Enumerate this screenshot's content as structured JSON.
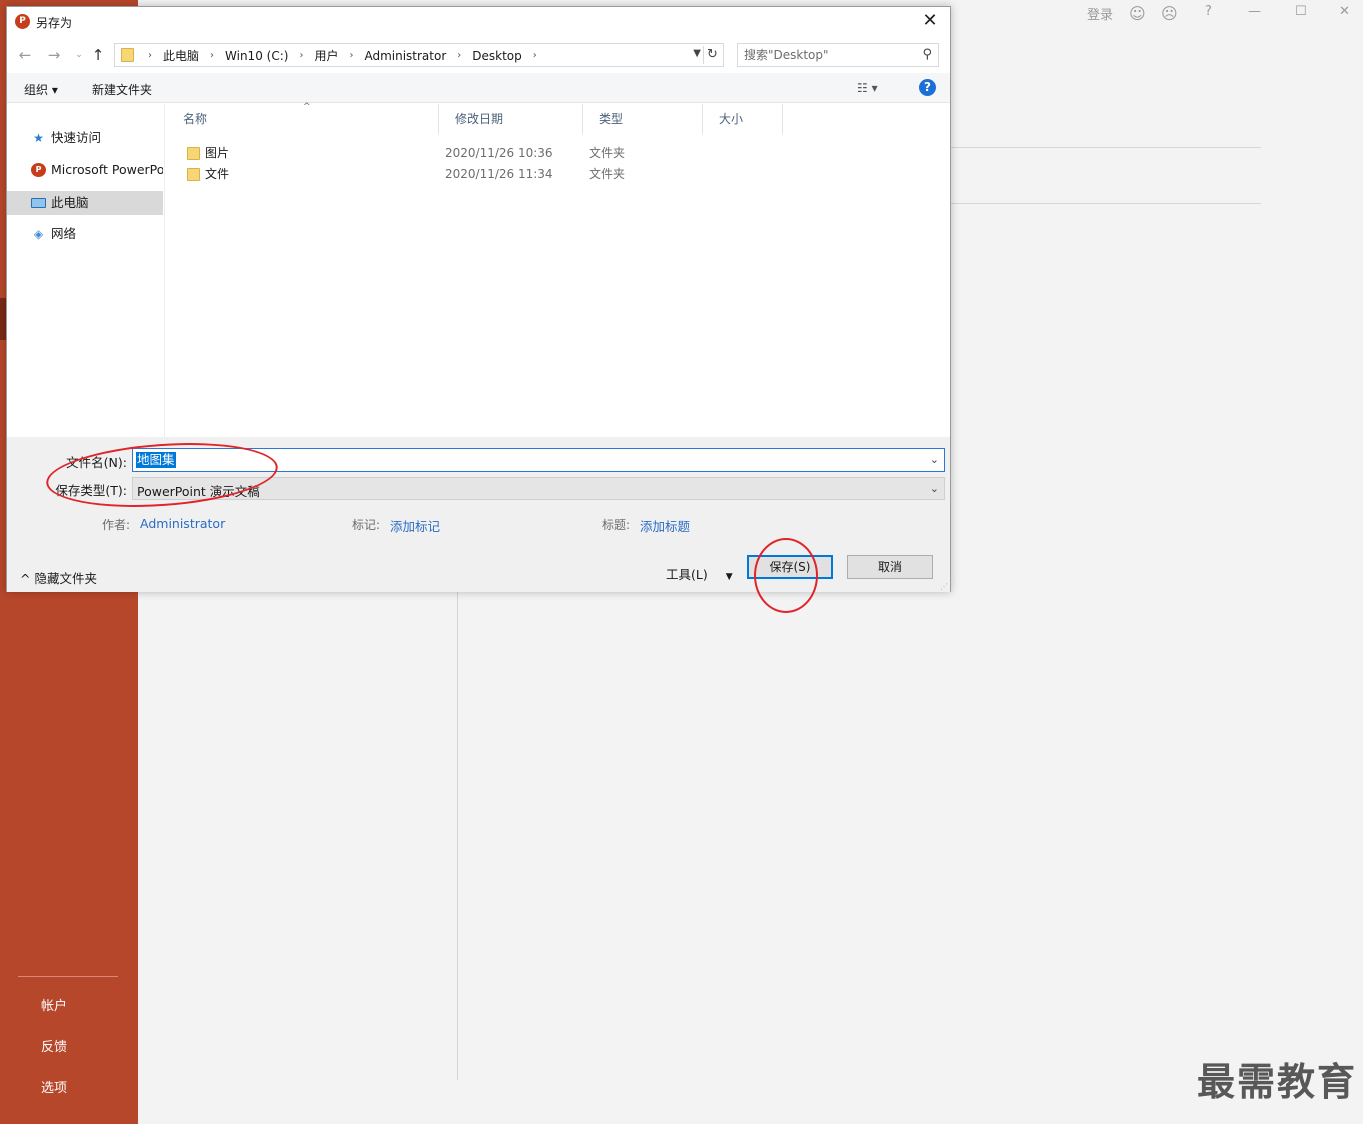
{
  "backstage": {
    "topbar": {
      "signin": "登录"
    },
    "sidebar": {
      "account": "帐户",
      "feedback": "反馈",
      "options": "选项"
    },
    "watermark": "最需教育"
  },
  "dialog": {
    "title": "另存为",
    "address": {
      "crumbs": [
        "此电脑",
        "Win10 (C:)",
        "用户",
        "Administrator",
        "Desktop"
      ]
    },
    "search": {
      "placeholder": "搜索\"Desktop\""
    },
    "toolbar": {
      "organize": "组织 ▾",
      "new_folder": "新建文件夹"
    },
    "nav": {
      "items": [
        {
          "label": "快速访问",
          "icon": "star-icon"
        },
        {
          "label": "Microsoft PowerPoint",
          "icon": "powerpoint-icon"
        },
        {
          "label": "此电脑",
          "icon": "computer-icon",
          "selected": true
        },
        {
          "label": "网络",
          "icon": "network-icon"
        }
      ]
    },
    "columns": {
      "name": "名称",
      "date": "修改日期",
      "type": "类型",
      "size": "大小"
    },
    "files": [
      {
        "name": "图片",
        "date": "2020/11/26 10:36",
        "type": "文件夹"
      },
      {
        "name": "文件",
        "date": "2020/11/26 11:34",
        "type": "文件夹"
      }
    ],
    "form": {
      "filename_label": "文件名(N):",
      "filename_value": "地图集",
      "filetype_label": "保存类型(T):",
      "filetype_value": "PowerPoint 演示文稿",
      "author_label": "作者:",
      "author_value": "Administrator",
      "tags_label": "标记:",
      "tags_value": "添加标记",
      "title_label": "标题:",
      "title_value": "添加标题"
    },
    "footer": {
      "hide_folders": "隐藏文件夹",
      "tools": "工具(L)",
      "save": "保存(S)",
      "cancel": "取消"
    }
  }
}
